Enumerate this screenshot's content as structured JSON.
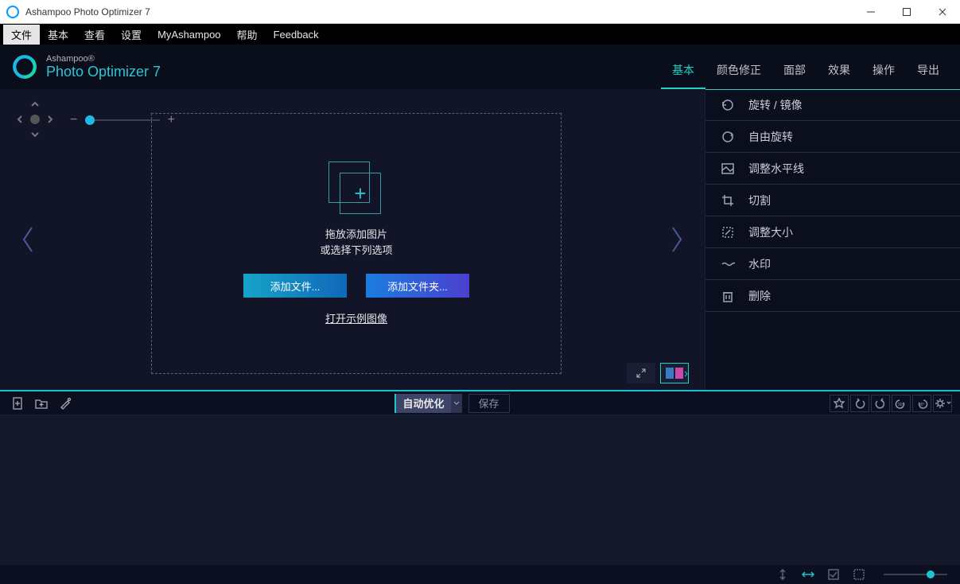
{
  "window": {
    "title": "Ashampoo Photo Optimizer 7"
  },
  "menubar": {
    "items": [
      "文件",
      "基本",
      "查看",
      "设置",
      "MyAshampoo",
      "帮助",
      "Feedback"
    ],
    "active_index": 0
  },
  "brand": {
    "line1": "Ashampoo®",
    "line2": "Photo Optimizer 7"
  },
  "tooltabs": {
    "items": [
      "基本",
      "颜色修正",
      "面部",
      "效果",
      "操作",
      "导出"
    ],
    "active_index": 0
  },
  "dropzone": {
    "line1": "拖放添加图片",
    "line2": "或选择下列选项",
    "btn_files": "添加文件...",
    "btn_folder": "添加文件夹...",
    "link_sample": "打开示例图像"
  },
  "sidebar_tools": [
    {
      "icon": "rotate",
      "label": "旋转 / 镜像"
    },
    {
      "icon": "free-rotate",
      "label": "自由旋转"
    },
    {
      "icon": "horizon",
      "label": "调整水平线"
    },
    {
      "icon": "crop",
      "label": "切割"
    },
    {
      "icon": "resize",
      "label": "调整大小"
    },
    {
      "icon": "watermark",
      "label": "水印"
    },
    {
      "icon": "delete",
      "label": "删除"
    }
  ],
  "midbar": {
    "auto_opt": "自动优化",
    "save": "保存"
  }
}
